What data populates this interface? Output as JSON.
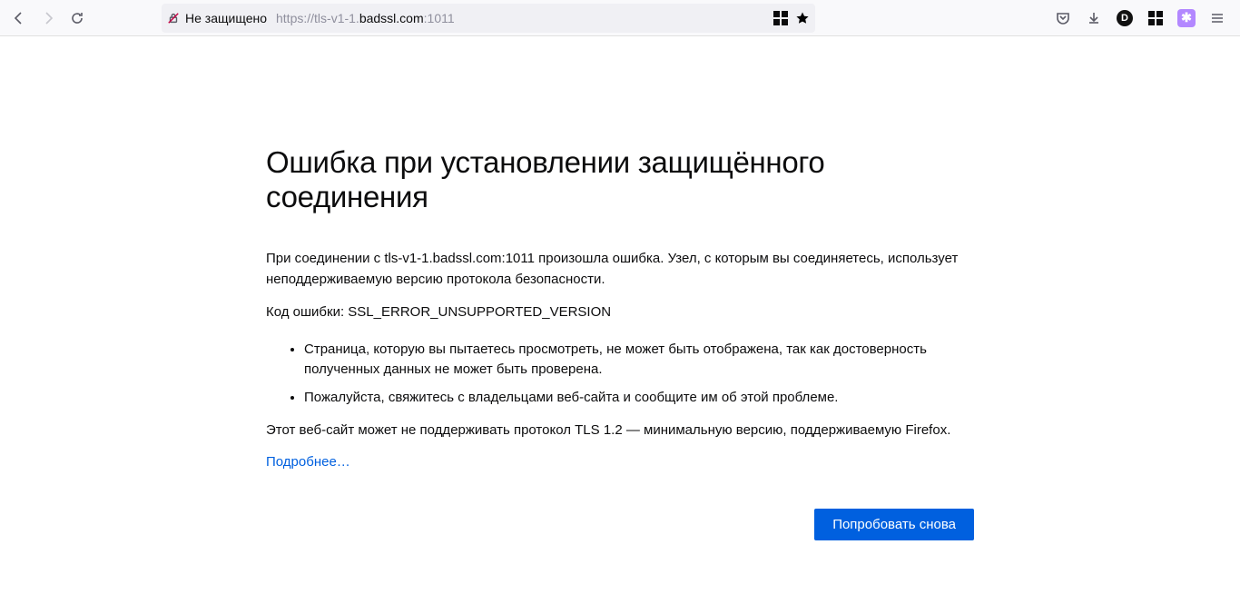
{
  "toolbar": {
    "security_label": "Не защищено",
    "url_scheme": "https://",
    "url_sub": "tls-v1-1.",
    "url_host": "badssl.com",
    "url_port": ":1011"
  },
  "error": {
    "title": "Ошибка при установлении защищённого соединения",
    "p1": "При соединении с tls-v1-1.badssl.com:1011 произошла ошибка. Узел, с которым вы соединяетесь, использует неподдерживаемую версию протокола безопасности.",
    "p2": "Код ошибки: SSL_ERROR_UNSUPPORTED_VERSION",
    "bullets": [
      "Страница, которую вы пытаетесь просмотреть, не может быть отображена, так как достоверность полученных данных не может быть проверена.",
      "Пожалуйста, свяжитесь с владельцами веб-сайта и сообщите им об этой проблеме."
    ],
    "p3": "Этот веб-сайт может не поддерживать протокол TLS 1.2 — минимальную версию, поддерживаемую Firefox.",
    "learn_more": "Подробнее…",
    "try_again": "Попробовать снова"
  }
}
